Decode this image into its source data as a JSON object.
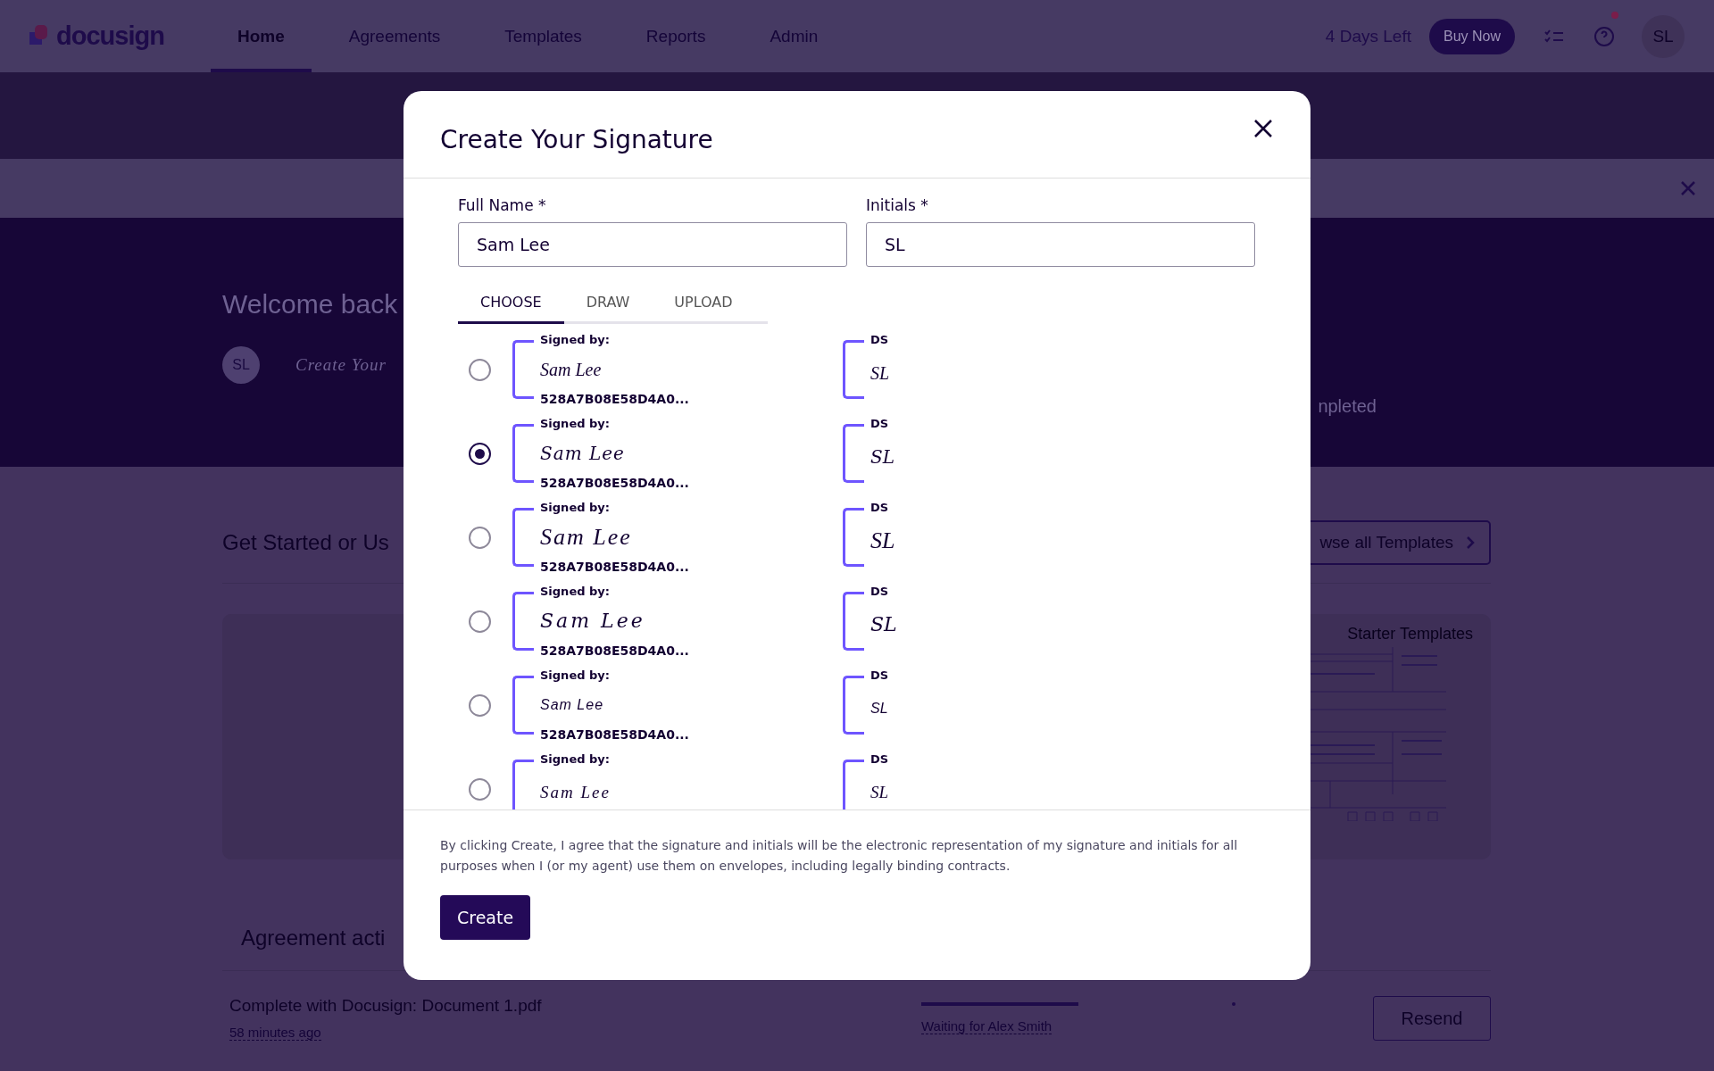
{
  "header": {
    "logo": "docusign",
    "nav": [
      {
        "label": "Home",
        "selected": true
      },
      {
        "label": "Agreements",
        "selected": false
      },
      {
        "label": "Templates",
        "selected": false
      },
      {
        "label": "Reports",
        "selected": false
      },
      {
        "label": "Admin",
        "selected": false
      }
    ],
    "trial": "4 Days Left",
    "buy_button": "Buy Now",
    "avatar": "SL"
  },
  "hero": {
    "title": "Welcome back",
    "avatar": "SL",
    "signature": "Create Your",
    "stat_label": "npleted"
  },
  "templates": {
    "title": "Get Started or Us",
    "browse_button": "wse all Templates",
    "card_title": "Starter Templates"
  },
  "activity": {
    "title": "Agreement acti",
    "rows": [
      {
        "name": "Complete with Docusign: Document 1.pdf",
        "time": "58 minutes ago",
        "status": "Waiting for Alex Smith",
        "level": 0.5,
        "action": "Resend"
      }
    ]
  },
  "modal": {
    "title": "Create Your Signature",
    "fields": [
      {
        "label": "Full Name *",
        "value": "Sam Lee"
      },
      {
        "label": "Initials *",
        "value": "SL"
      }
    ],
    "tabs": [
      {
        "label": "CHOOSE",
        "selected": true
      },
      {
        "label": "DRAW",
        "selected": false
      },
      {
        "label": "UPLOAD",
        "selected": false
      }
    ],
    "options": [
      {
        "selected": false,
        "signed_by": "Signed by:",
        "signature": "Sam Lee",
        "hash": "528A7B08E58D4A0...",
        "initials_label": "DS",
        "initials": "SL"
      },
      {
        "selected": true,
        "signed_by": "Signed by:",
        "signature": "Sam Lee",
        "hash": "528A7B08E58D4A0...",
        "initials_label": "DS",
        "initials": "SL"
      },
      {
        "selected": false,
        "signed_by": "Signed by:",
        "signature": "Sam Lee",
        "hash": "528A7B08E58D4A0...",
        "initials_label": "DS",
        "initials": "SL"
      },
      {
        "selected": false,
        "signed_by": "Signed by:",
        "signature": "Sam Lee",
        "hash": "528A7B08E58D4A0...",
        "initials_label": "DS",
        "initials": "SL"
      },
      {
        "selected": false,
        "signed_by": "Signed by:",
        "signature": "Sam Lee",
        "hash": "528A7B08E58D4A0...",
        "initials_label": "DS",
        "initials": "SL"
      },
      {
        "selected": false,
        "signed_by": "Signed by:",
        "signature": "Sam Lee",
        "initials_label": "DS",
        "initials": "SL"
      }
    ],
    "consent": "By clicking Create, I agree that the signature and initials will be the electronic representation of my signature and initials for all purposes when I (or my agent) use them on envelopes, including legally binding contracts.",
    "create_button": "Create"
  }
}
